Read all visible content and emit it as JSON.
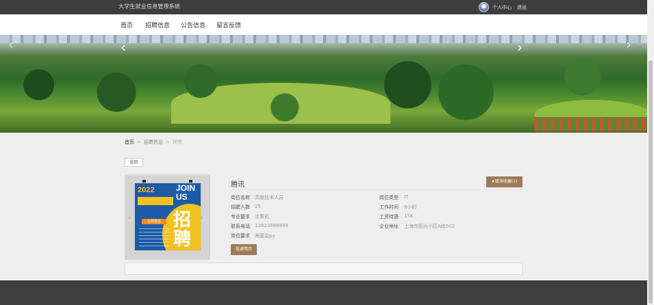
{
  "header": {
    "site_title": "大学生就业信息管理系统",
    "user_center": "个人中心",
    "logout": "退出"
  },
  "nav": {
    "items": [
      {
        "label": "首页"
      },
      {
        "label": "招聘信息"
      },
      {
        "label": "公告信息"
      },
      {
        "label": "留言反馈"
      }
    ]
  },
  "banner": {
    "prev_icon": "‹",
    "next_icon": "›"
  },
  "breadcrumb": {
    "home": "首页",
    "section": "招聘信息",
    "current": "详情",
    "separator": ">"
  },
  "back_label": "返回",
  "poster": {
    "year": "2022",
    "join_text": "JOIN US",
    "big_text": "招聘",
    "tag": "立即报名",
    "prev_icon": "‹",
    "next_icon": "›"
  },
  "detail": {
    "company": "腾讯",
    "cancel_favorite": "★取消收藏(1)",
    "fields_left": [
      {
        "label": "岗位名称",
        "value": "高级技术人员"
      },
      {
        "label": "招聘人数",
        "value": "25"
      },
      {
        "label": "专业要求",
        "value": "计算机"
      },
      {
        "label": "联系电话",
        "value": "13823888888"
      },
      {
        "label": "岗位要求",
        "value": "需要会py"
      }
    ],
    "fields_right": [
      {
        "label": "岗位类型",
        "value": "IT"
      },
      {
        "label": "工作时间",
        "value": "8小时"
      },
      {
        "label": "工资待遇",
        "value": "15K"
      },
      {
        "label": "企业地址",
        "value": "上海市阳光小区A栋502"
      }
    ],
    "apply_label": "投递简历"
  },
  "colors": {
    "topbar": "#3d3d3d",
    "accent_button": "#9b7c56",
    "footer": "#3f3f3f"
  }
}
